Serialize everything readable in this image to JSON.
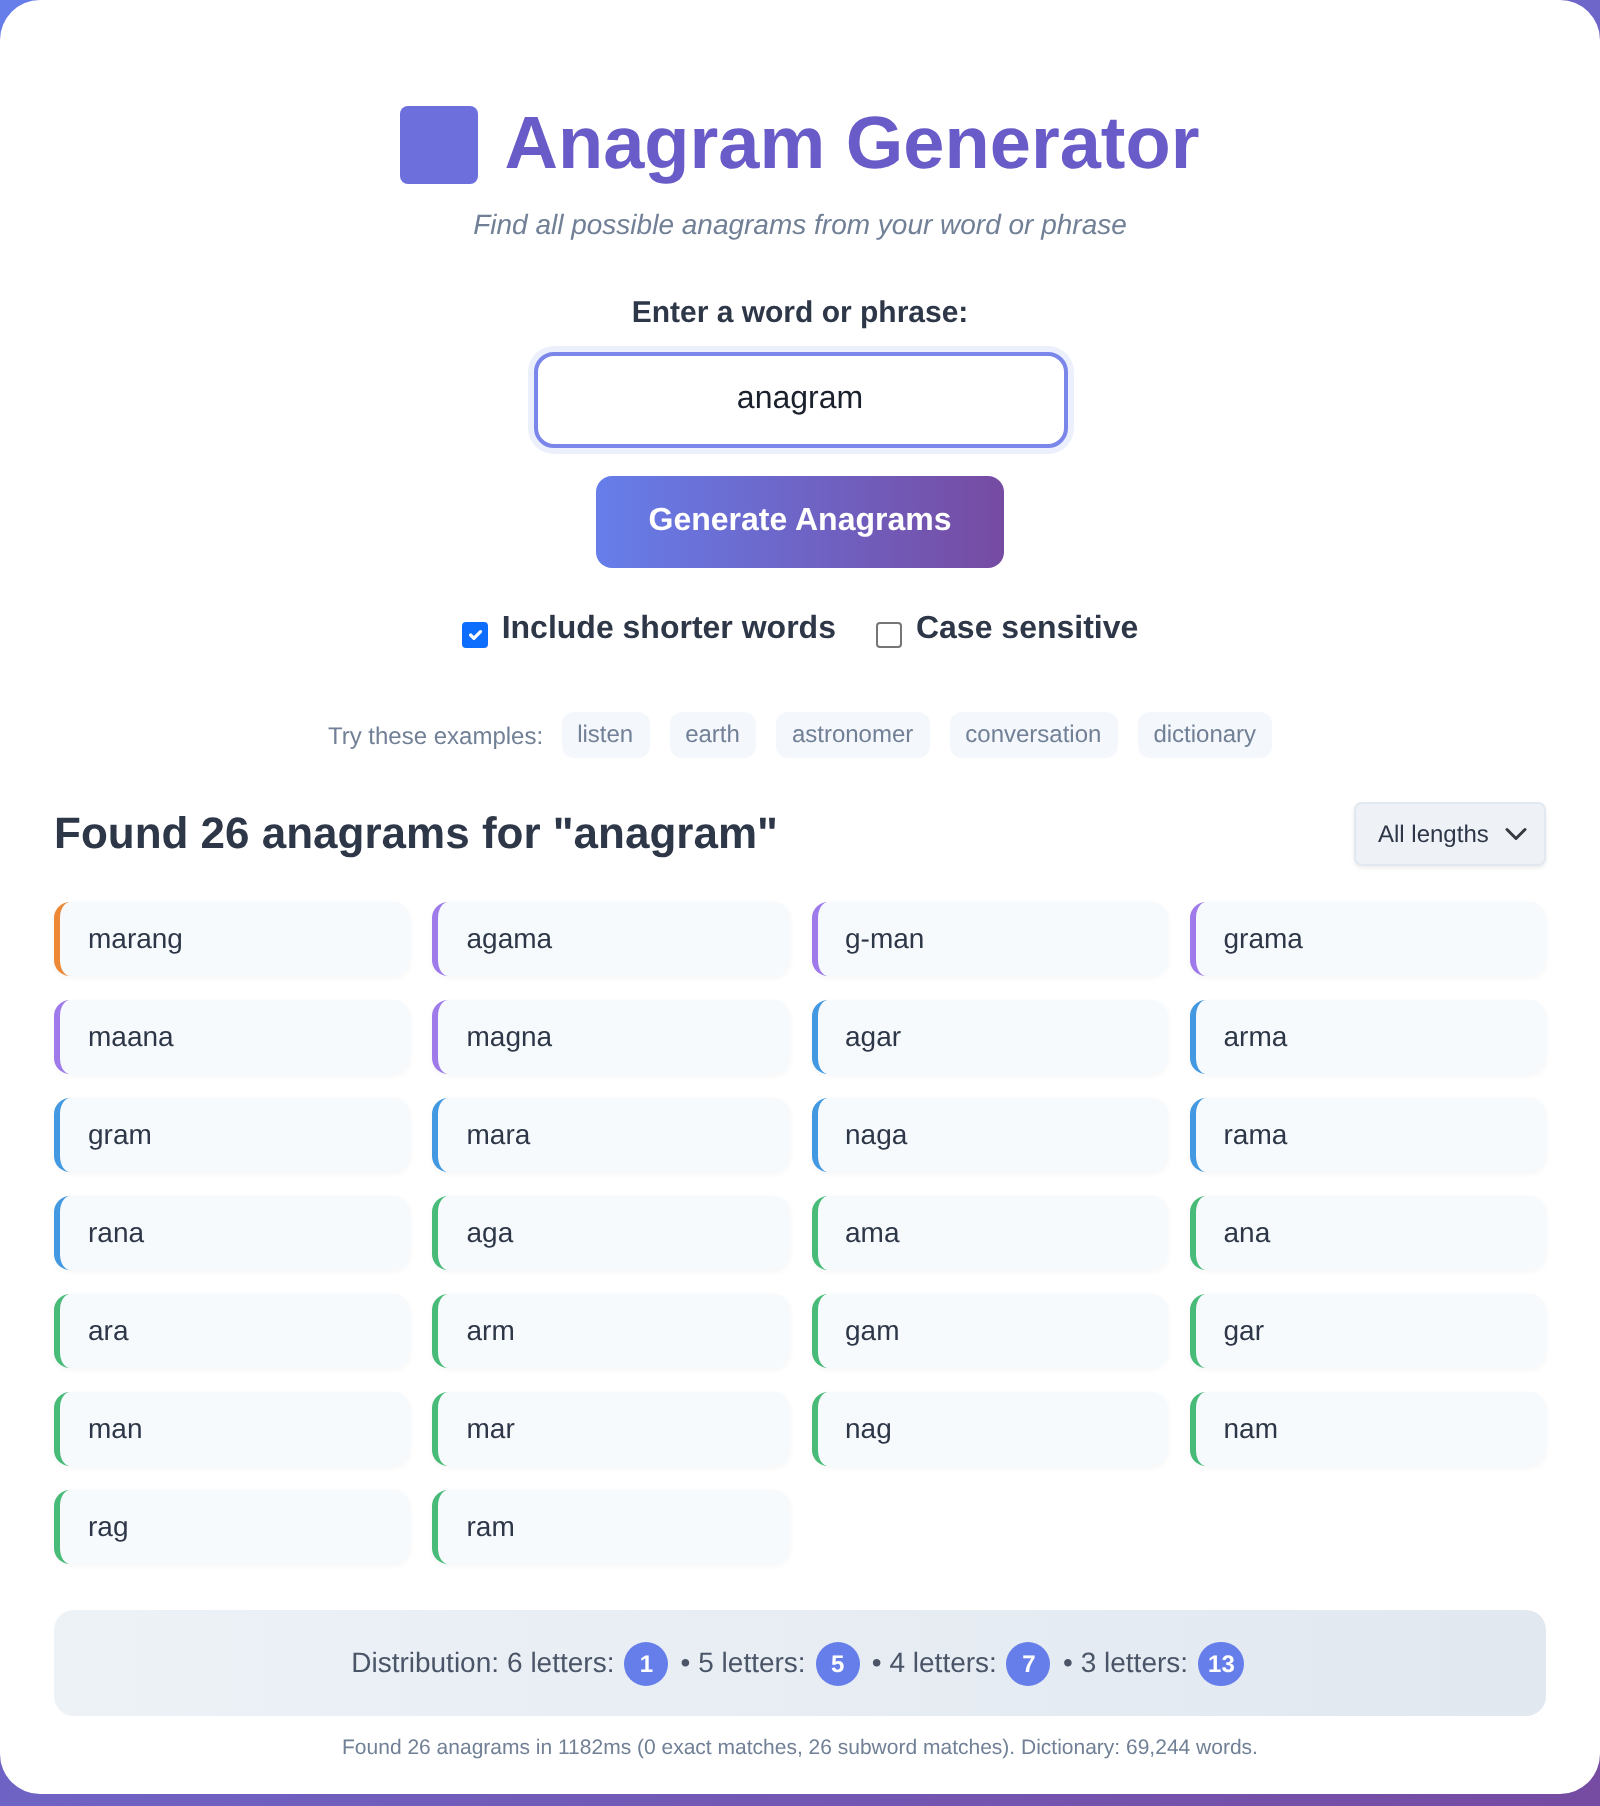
{
  "header": {
    "title": "Anagram Generator",
    "subtitle": "Find all possible anagrams from your word or phrase"
  },
  "form": {
    "label": "Enter a word or phrase:",
    "value": "anagram",
    "button": "Generate Anagrams",
    "options": [
      {
        "label": "Include shorter words",
        "checked": true
      },
      {
        "label": "Case sensitive",
        "checked": false
      }
    ]
  },
  "examples": {
    "label": "Try these examples:",
    "items": [
      "listen",
      "earth",
      "astronomer",
      "conversation",
      "dictionary"
    ]
  },
  "results": {
    "heading": "Found 26 anagrams for \"anagram\"",
    "filter": "All lengths",
    "words": [
      {
        "text": "marang",
        "color": "#ed8936"
      },
      {
        "text": "agama",
        "color": "#9f7aea"
      },
      {
        "text": "g-man",
        "color": "#9f7aea"
      },
      {
        "text": "grama",
        "color": "#9f7aea"
      },
      {
        "text": "maana",
        "color": "#9f7aea"
      },
      {
        "text": "magna",
        "color": "#9f7aea"
      },
      {
        "text": "agar",
        "color": "#4299e1"
      },
      {
        "text": "arma",
        "color": "#4299e1"
      },
      {
        "text": "gram",
        "color": "#4299e1"
      },
      {
        "text": "mara",
        "color": "#4299e1"
      },
      {
        "text": "naga",
        "color": "#4299e1"
      },
      {
        "text": "rama",
        "color": "#4299e1"
      },
      {
        "text": "rana",
        "color": "#4299e1"
      },
      {
        "text": "aga",
        "color": "#48bb78"
      },
      {
        "text": "ama",
        "color": "#48bb78"
      },
      {
        "text": "ana",
        "color": "#48bb78"
      },
      {
        "text": "ara",
        "color": "#48bb78"
      },
      {
        "text": "arm",
        "color": "#48bb78"
      },
      {
        "text": "gam",
        "color": "#48bb78"
      },
      {
        "text": "gar",
        "color": "#48bb78"
      },
      {
        "text": "man",
        "color": "#48bb78"
      },
      {
        "text": "mar",
        "color": "#48bb78"
      },
      {
        "text": "nag",
        "color": "#48bb78"
      },
      {
        "text": "nam",
        "color": "#48bb78"
      },
      {
        "text": "rag",
        "color": "#48bb78"
      },
      {
        "text": "ram",
        "color": "#48bb78"
      }
    ]
  },
  "distribution": {
    "label": "Distribution:",
    "groups": [
      {
        "label": "6 letters:",
        "count": "1"
      },
      {
        "separator": "•",
        "label": "5 letters:",
        "count": "5"
      },
      {
        "separator": "•",
        "label": "4 letters:",
        "count": "7"
      },
      {
        "separator": "•",
        "label": "3 letters:",
        "count": "13"
      }
    ]
  },
  "footer": "Found 26 anagrams in 1182ms (0 exact matches, 26 subword matches). Dictionary: 69,244 words."
}
